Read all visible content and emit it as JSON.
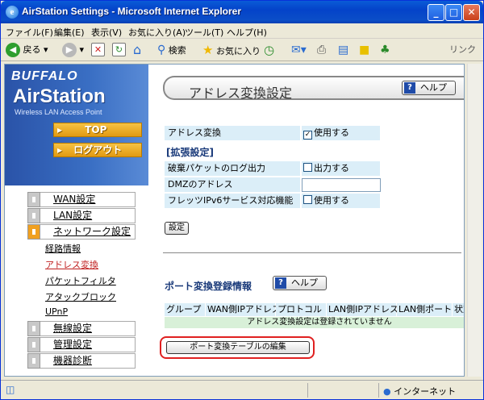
{
  "window": {
    "title": "AirStation Settings - Microsoft Internet Explorer"
  },
  "menu": [
    "ファイル(F)",
    "編集(E)",
    "表示(V)",
    "お気に入り(A)",
    "ツール(T)",
    "ヘルプ(H)"
  ],
  "toolbar": {
    "back": "戻る",
    "search": "検索",
    "favorites": "お気に入り",
    "links": "リンク"
  },
  "brand": {
    "name": "BUFFALO",
    "product": "AirStation",
    "tagline": "Wireless LAN Access Point"
  },
  "quick": {
    "top": "TOP",
    "logout": "ログアウト"
  },
  "nav": {
    "wan": "WAN設定",
    "lan": "LAN設定",
    "network": "ネットワーク設定",
    "sub": [
      "経路情報",
      "アドレス変換",
      "パケットフィルタ",
      "アタックブロック",
      "UPnP"
    ],
    "wireless": "無線設定",
    "admin": "管理設定",
    "diag": "機器診断"
  },
  "main": {
    "title": "アドレス変換設定",
    "help": "ヘルプ",
    "nat_label": "アドレス変換",
    "nat_value": "使用する",
    "ext_head": "[拡張設定]",
    "log_label": "破棄パケットのログ出力",
    "log_value": "出力する",
    "dmz_label": "DMZのアドレス",
    "ipv6_label": "フレッツIPv6サービス対応機能",
    "ipv6_value": "使用する",
    "apply": "設定",
    "port_head": "ポート変換登録情報",
    "port_help": "ヘルプ",
    "cols": [
      "グループ",
      "WAN側IPアドレス",
      "プロトコル",
      "LAN側IPアドレス",
      "LAN側ポート",
      "状態"
    ],
    "empty_msg": "アドレス変換設定は登録されていません",
    "edit_button": "ポート変換テーブルの編集"
  },
  "status": {
    "zone": "インターネット"
  },
  "checks": {
    "nat": true,
    "log": false,
    "ipv6": false
  }
}
